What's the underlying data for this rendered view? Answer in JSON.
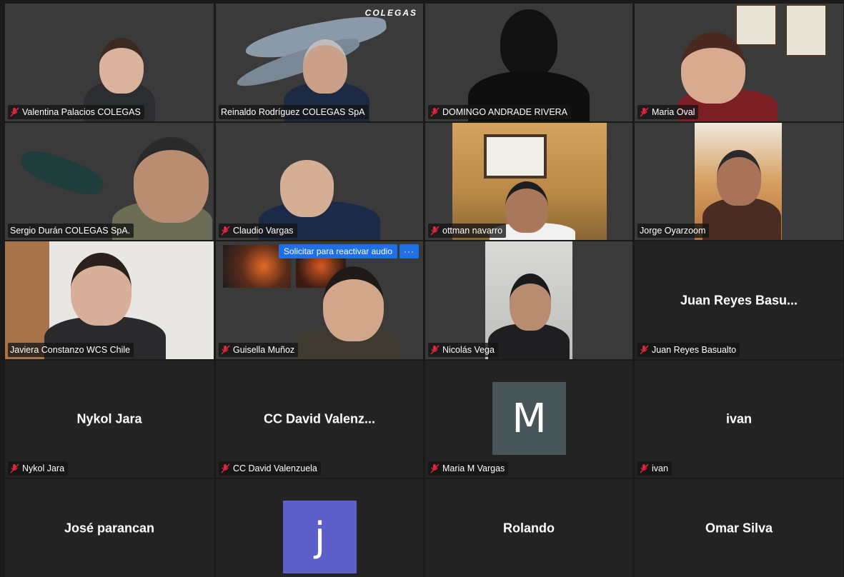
{
  "colors": {
    "tile_bg": "#232323",
    "active_speaker": "#d9d96a",
    "button_blue": "#1f6fe5",
    "avatar_m": "#485559",
    "avatar_j": "#5b5fc7",
    "muted_icon": "#e0263a"
  },
  "banner": {
    "logo_text": "COLEGAS"
  },
  "participants": [
    {
      "name": "Valentina Palacios COLEGAS",
      "muted": true
    },
    {
      "name": "Reinaldo Rodríguez  COLEGAS SpA",
      "muted": false
    },
    {
      "name": "DOMINGO ANDRADE RIVERA",
      "muted": true
    },
    {
      "name": "Maria Oval",
      "muted": true
    },
    {
      "name": "Sergio Durán COLEGAS SpA.",
      "muted": false
    },
    {
      "name": "Claudio Vargas",
      "muted": true
    },
    {
      "name": "ottman navarro",
      "muted": true
    },
    {
      "name": "Jorge Oyarzoom",
      "muted": false
    },
    {
      "name": "Javiera Constanzo WCS Chile",
      "muted": false,
      "speaking": true
    },
    {
      "name": "Guisella Muñoz",
      "muted": true
    },
    {
      "name": "Nicolás Vega",
      "muted": true
    },
    {
      "name": "Juan Reyes Basualto",
      "display": "Juan Reyes Basu...",
      "muted": true
    },
    {
      "name": "Nykol Jara",
      "display": "Nykol Jara",
      "muted": true
    },
    {
      "name": "CC David Valenzuela",
      "display": "CC David Valenz...",
      "muted": true
    },
    {
      "name": "Maria M Vargas",
      "avatar_letter": "M",
      "muted": true
    },
    {
      "name": "ivan",
      "display": "ivan",
      "muted": true
    },
    {
      "display": "José parancan"
    },
    {
      "avatar_letter": "j"
    },
    {
      "display": "Rolando"
    },
    {
      "display": "Omar Silva"
    }
  ],
  "request_unmute": {
    "label": "Solicitar para reactivar audio",
    "more_label": "···"
  }
}
